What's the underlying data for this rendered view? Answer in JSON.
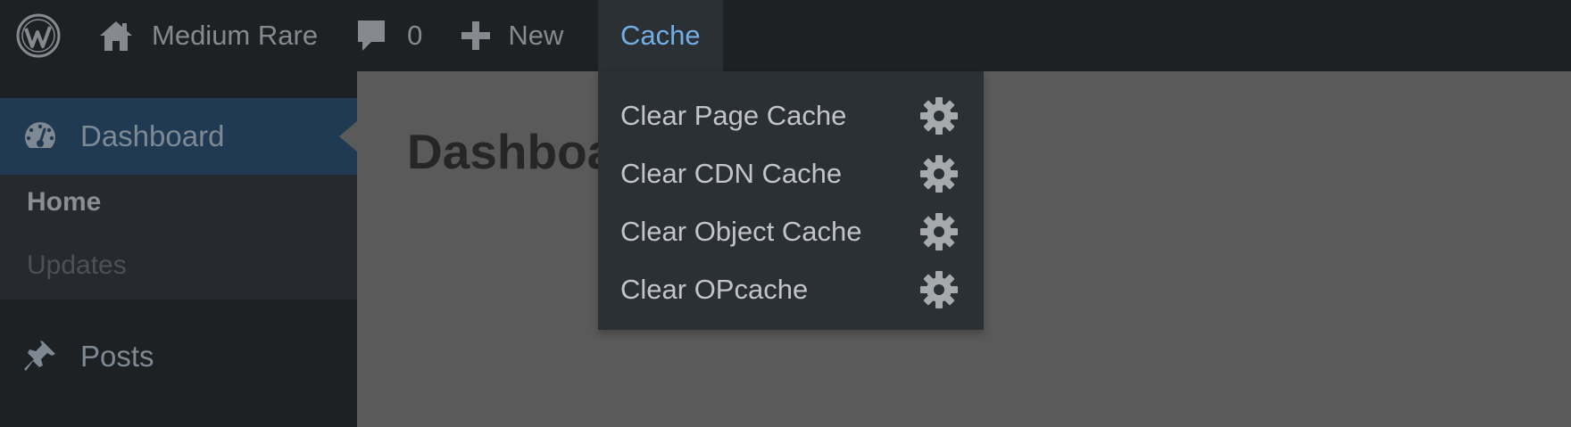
{
  "adminbar": {
    "site_name": "Medium Rare",
    "comments_count": "0",
    "new_label": "New",
    "cache_label": "Cache"
  },
  "sidebar": {
    "dashboard_label": "Dashboard",
    "submenu": [
      {
        "label": "Home"
      },
      {
        "label": "Updates"
      }
    ],
    "posts_label": "Posts"
  },
  "content": {
    "page_title": "Dashboard"
  },
  "cache_menu": {
    "items": [
      {
        "label": "Clear Page Cache",
        "icon": "gear-icon"
      },
      {
        "label": "Clear CDN Cache",
        "icon": "gear-icon"
      },
      {
        "label": "Clear Object Cache",
        "icon": "gear-icon"
      },
      {
        "label": "Clear OPcache",
        "icon": "gear-icon"
      }
    ]
  },
  "colors": {
    "adminbar_bg": "#1e2124",
    "dropdown_bg": "#2b3035",
    "accent": "#72aee6",
    "active_menu_bg": "#1f3a52",
    "content_bg": "#5a5a5a"
  }
}
